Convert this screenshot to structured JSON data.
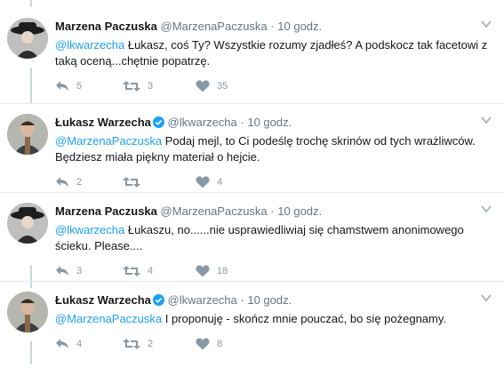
{
  "tweets": [
    {
      "name": "Marzena Paczuska",
      "handle": "@MarzenaPaczuska",
      "dot": "·",
      "time": "10 godz.",
      "verified": false,
      "mention": "@lkwarzecha",
      "text": " Łukasz, coś Ty? Wszystkie rozumy zjadłeś? A podskocz tak facetowi z taką oceną...chętnie popatrzę.",
      "reply_count": "5",
      "retweet_count": "3",
      "like_count": "35"
    },
    {
      "name": "Łukasz Warzecha",
      "handle": "@lkwarzecha",
      "dot": "·",
      "time": "10 godz.",
      "verified": true,
      "mention": "@MarzenaPaczuska",
      "text": " Podaj mejl, to Ci podeślę trochę skrinów od tych wrażliwców. Będziesz miała piękny materiał o hejcie.",
      "reply_count": "2",
      "retweet_count": "",
      "like_count": "4"
    },
    {
      "name": "Marzena Paczuska",
      "handle": "@MarzenaPaczuska",
      "dot": "·",
      "time": "10 godz.",
      "verified": false,
      "mention": "@lkwarzecha",
      "text": " Łukaszu, no......nie usprawiedliwiaj się chamstwem anonimowego ścieku. Please....",
      "reply_count": "3",
      "retweet_count": "4",
      "like_count": "18"
    },
    {
      "name": "Łukasz Warzecha",
      "handle": "@lkwarzecha",
      "dot": "·",
      "time": "10 godz.",
      "verified": true,
      "mention": "@MarzenaPaczuska",
      "text": " I proponuję - skończ mnie pouczać, bo się pożegnamy.",
      "reply_count": "4",
      "retweet_count": "2",
      "like_count": "8"
    }
  ],
  "colors": {
    "link": "#1da1f2",
    "verified": "#1da1f2",
    "muted": "#657786",
    "action_icon": "#8899a6",
    "thread_line": "#ccd6dd",
    "separator": "#e6ecf0"
  },
  "icons": {
    "reply": "reply-icon",
    "retweet": "retweet-icon",
    "like": "heart-icon",
    "more": "caret-down-icon",
    "verified": "verified-badge-icon"
  }
}
